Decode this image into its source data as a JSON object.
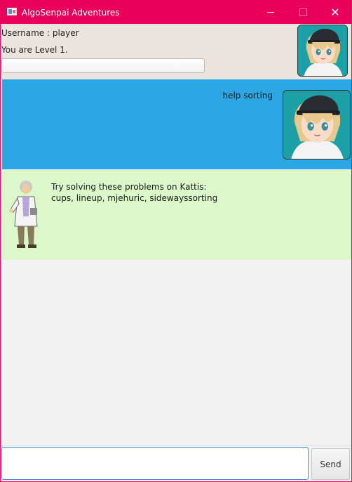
{
  "window": {
    "title": "AlgoSenpai Adventures",
    "accent_color": "#e8005a",
    "controls": {
      "minimize": "minimize-icon",
      "maximize": "maximize-icon",
      "close_glyph": "✕"
    }
  },
  "header": {
    "username": "Username : player",
    "level": "You are Level 1.",
    "progress_fraction": 0.0
  },
  "chat": {
    "messages": [
      {
        "sender": "user",
        "text": "help sorting",
        "bg": "#2da7e3"
      },
      {
        "sender": "bot",
        "lines": [
          "Try solving these problems on Kattis:",
          "cups, lineup, mjehuric, sidewayssorting"
        ],
        "bg": "#dcf7c9"
      }
    ]
  },
  "input": {
    "value": "",
    "placeholder": ""
  },
  "send_button": {
    "label": "Send"
  }
}
